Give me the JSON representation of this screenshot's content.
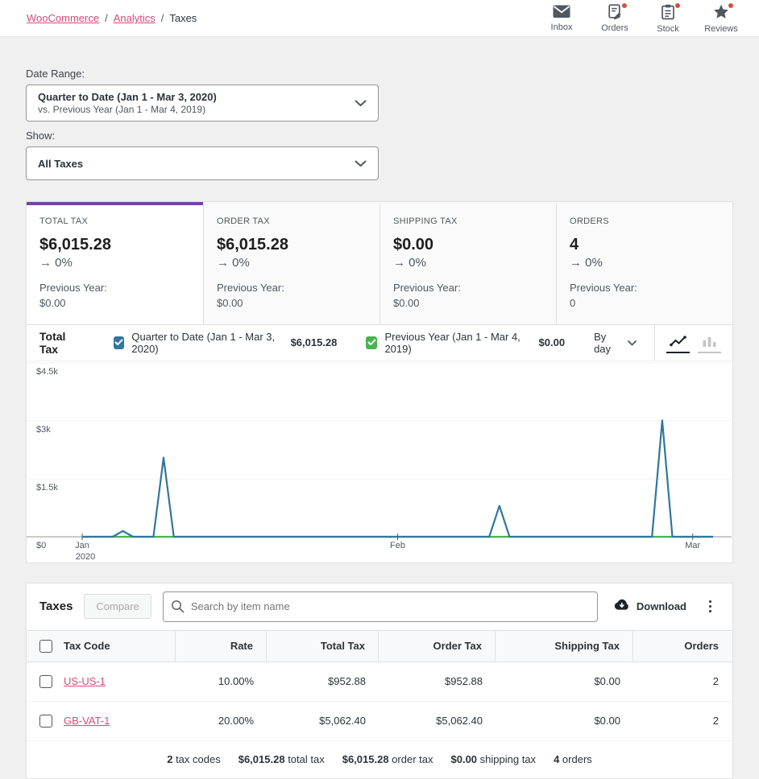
{
  "colors": {
    "link": "#d9487b",
    "accent_purple": "#7144a1",
    "badge_red": "#d94f3d",
    "series_primary": "#31769f",
    "series_secondary": "#46b450"
  },
  "icons": {
    "trend_arrow": "→"
  },
  "header": {
    "breadcrumb": {
      "item1": "WooCommerce",
      "item2": "Analytics",
      "item3": "Taxes",
      "separator": "/"
    },
    "activity": {
      "inbox": {
        "label": "Inbox"
      },
      "orders": {
        "label": "Orders"
      },
      "stock": {
        "label": "Stock"
      },
      "reviews": {
        "label": "Reviews"
      }
    }
  },
  "filters": {
    "date_range_label": "Date Range:",
    "date_range_primary": "Quarter to Date (Jan 1 - Mar 3, 2020)",
    "date_range_secondary": "vs. Previous Year (Jan 1 - Mar 4, 2019)",
    "show_label": "Show:",
    "show_value": "All Taxes"
  },
  "summary_cards": [
    {
      "label": "TOTAL TAX",
      "value": "$6,015.28",
      "delta": "0%",
      "prev_label": "Previous Year:",
      "prev_value": "$0.00"
    },
    {
      "label": "ORDER TAX",
      "value": "$6,015.28",
      "delta": "0%",
      "prev_label": "Previous Year:",
      "prev_value": "$0.00"
    },
    {
      "label": "SHIPPING TAX",
      "value": "$0.00",
      "delta": "0%",
      "prev_label": "Previous Year:",
      "prev_value": "$0.00"
    },
    {
      "label": "ORDERS",
      "value": "4",
      "delta": "0%",
      "prev_label": "Previous Year:",
      "prev_value": "0"
    }
  ],
  "chart": {
    "title": "Total Tax",
    "legend": [
      {
        "label": "Quarter to Date (Jan 1 - Mar 3, 2020)",
        "value": "$6,015.28",
        "color": "#31769f"
      },
      {
        "label": "Previous Year (Jan 1 - Mar 4, 2019)",
        "value": "$0.00",
        "color": "#46b450"
      }
    ],
    "interval_label": "By day"
  },
  "chart_data": {
    "type": "line",
    "title": "Total Tax",
    "x_unit": "day",
    "x_range": "Jan 1, 2020 - Mar 3, 2020",
    "num_points": 63,
    "x_tick_indices": [
      0,
      31,
      60
    ],
    "x_tick_labels": [
      "Jan",
      "Feb",
      "Mar"
    ],
    "x_tick_sub_label": "2020",
    "y_ticks": [
      0,
      1500,
      3000,
      4500
    ],
    "y_tick_labels": [
      "$0",
      "$1.5k",
      "$3k",
      "$4.5k"
    ],
    "ylim": [
      0,
      4650
    ],
    "grid": true,
    "series": [
      {
        "name": "Quarter to Date (Jan 1 - Mar 3, 2020)",
        "color": "#31769f",
        "displayed_total": "$6,015.28",
        "baseline_value": 0,
        "spikes": [
          {
            "index": 4,
            "date": "Jan 5, 2020",
            "value": 150
          },
          {
            "index": 8,
            "date": "Jan 9, 2020",
            "value": 2050
          },
          {
            "index": 41,
            "date": "Feb 11, 2020",
            "value": 803
          },
          {
            "index": 57,
            "date": "Feb 27, 2020",
            "value": 3012
          }
        ]
      },
      {
        "name": "Previous Year (Jan 1 - Mar 4, 2019)",
        "color": "#46b450",
        "displayed_total": "$0.00",
        "baseline_value": 0,
        "spikes": []
      }
    ]
  },
  "table": {
    "title": "Taxes",
    "compare_label": "Compare",
    "search_placeholder": "Search by item name",
    "download_label": "Download",
    "columns": [
      "Tax Code",
      "Rate",
      "Total Tax",
      "Order Tax",
      "Shipping Tax",
      "Orders"
    ],
    "rows": [
      {
        "tax_code": "US-US-1",
        "rate": "10.00%",
        "total_tax": "$952.88",
        "order_tax": "$952.88",
        "shipping_tax": "$0.00",
        "orders": "2"
      },
      {
        "tax_code": "GB-VAT-1",
        "rate": "20.00%",
        "total_tax": "$5,062.40",
        "order_tax": "$5,062.40",
        "shipping_tax": "$0.00",
        "orders": "2"
      }
    ],
    "summary": [
      {
        "value": "2",
        "label": "tax codes"
      },
      {
        "value": "$6,015.28",
        "label": "total tax"
      },
      {
        "value": "$6,015.28",
        "label": "order tax"
      },
      {
        "value": "$0.00",
        "label": "shipping tax"
      },
      {
        "value": "4",
        "label": "orders"
      }
    ]
  }
}
